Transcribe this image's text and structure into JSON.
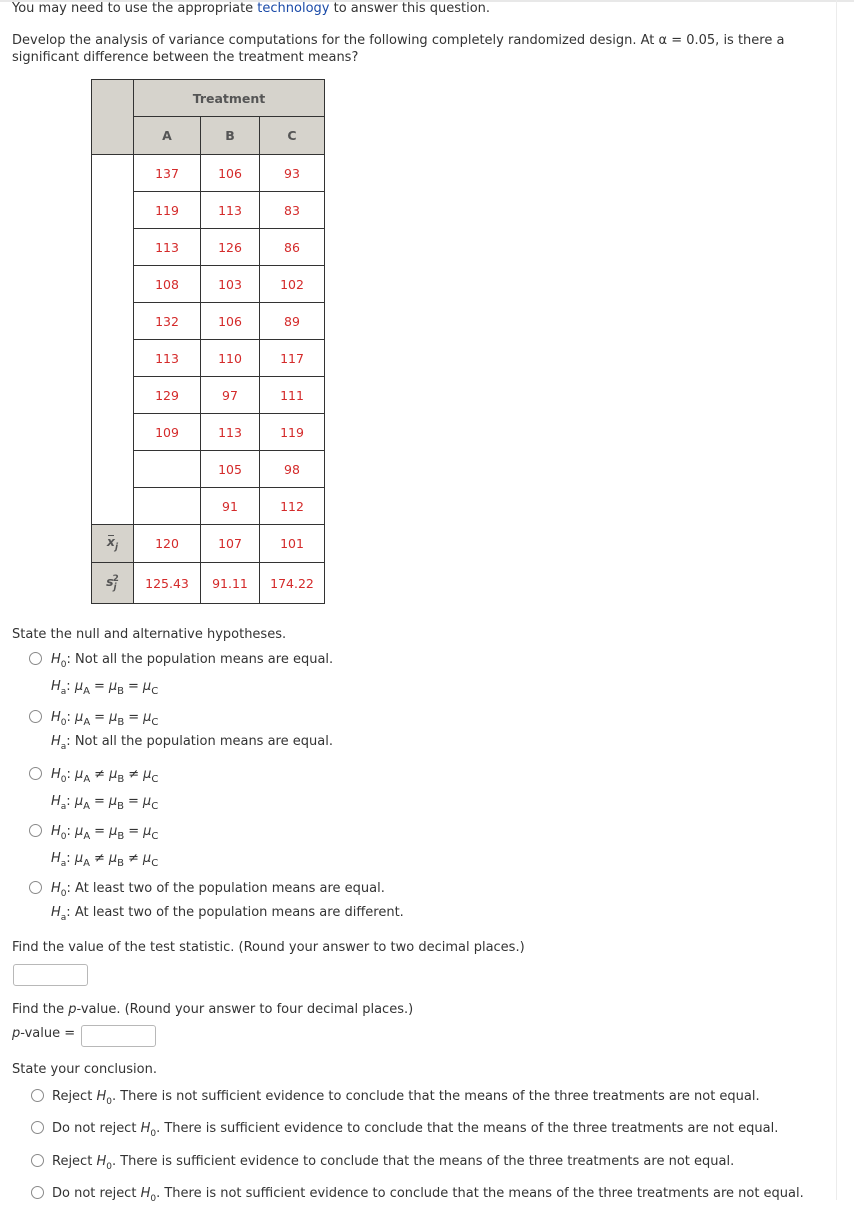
{
  "header": {
    "intro_before": "You may need to use the appropriate ",
    "intro_link": "technology",
    "intro_after": " to answer this question.",
    "question": "Develop the analysis of variance computations for the following completely randomized design. At α = 0.05, is there a significant difference between the treatment means?"
  },
  "table": {
    "group_header": "Treatment",
    "columns": [
      "A",
      "B",
      "C"
    ],
    "rows": [
      [
        "137",
        "106",
        "93"
      ],
      [
        "119",
        "113",
        "83"
      ],
      [
        "113",
        "126",
        "86"
      ],
      [
        "108",
        "103",
        "102"
      ],
      [
        "132",
        "106",
        "89"
      ],
      [
        "113",
        "110",
        "117"
      ],
      [
        "129",
        "97",
        "111"
      ],
      [
        "109",
        "113",
        "119"
      ],
      [
        "",
        "105",
        "98"
      ],
      [
        "",
        "91",
        "112"
      ]
    ],
    "mean_label": "x",
    "mean_sub": "j",
    "means": [
      "120",
      "107",
      "101"
    ],
    "var_label": "s",
    "var_sub": "j",
    "var_sup": "2",
    "variances": [
      "125.43",
      "91.11",
      "174.22"
    ]
  },
  "hypotheses": {
    "title": "State the null and alternative hypotheses.",
    "options": [
      {
        "h0": "Not all the population means are equal.",
        "ha": "μA = μB = μC"
      },
      {
        "h0": "μA = μB = μC",
        "ha": "Not all the population means are equal."
      },
      {
        "h0": "μA ≠ μB ≠ μC",
        "ha": "μA = μB = μC"
      },
      {
        "h0": "μA = μB = μC",
        "ha": "μA ≠ μB ≠ μC"
      },
      {
        "h0": "At least two of the population means are equal.",
        "ha": "At least two of the population means are different."
      }
    ],
    "h_symbol": "H",
    "h0_sub": "0",
    "ha_sub": "a",
    "mu": "μ",
    "eq": "=",
    "neq": "≠"
  },
  "test_statistic": {
    "prompt": "Find the value of the test statistic. (Round your answer to two decimal places.)",
    "value": ""
  },
  "p_value": {
    "prompt_before": "Find the ",
    "prompt_p": "p",
    "prompt_after": "-value. (Round your answer to four decimal places.)",
    "label_p": "p",
    "label_rest": "-value =",
    "value": ""
  },
  "conclusion": {
    "title": "State your conclusion.",
    "options": [
      {
        "action": "Reject ",
        "rest": ". There is not sufficient evidence to conclude that the means of the three treatments are not equal."
      },
      {
        "action": "Do not reject ",
        "rest": ". There is sufficient evidence to conclude that the means of the three treatments are not equal."
      },
      {
        "action": "Reject ",
        "rest": ". There is sufficient evidence to conclude that the means of the three treatments are not equal."
      },
      {
        "action": "Do not reject ",
        "rest": ". There is not sufficient evidence to conclude that the means of the three treatments are not equal."
      }
    ]
  },
  "colors": {
    "data_value": "#d42a2a",
    "header_bg": "#d6d3cc",
    "link": "#1a4aa8"
  }
}
